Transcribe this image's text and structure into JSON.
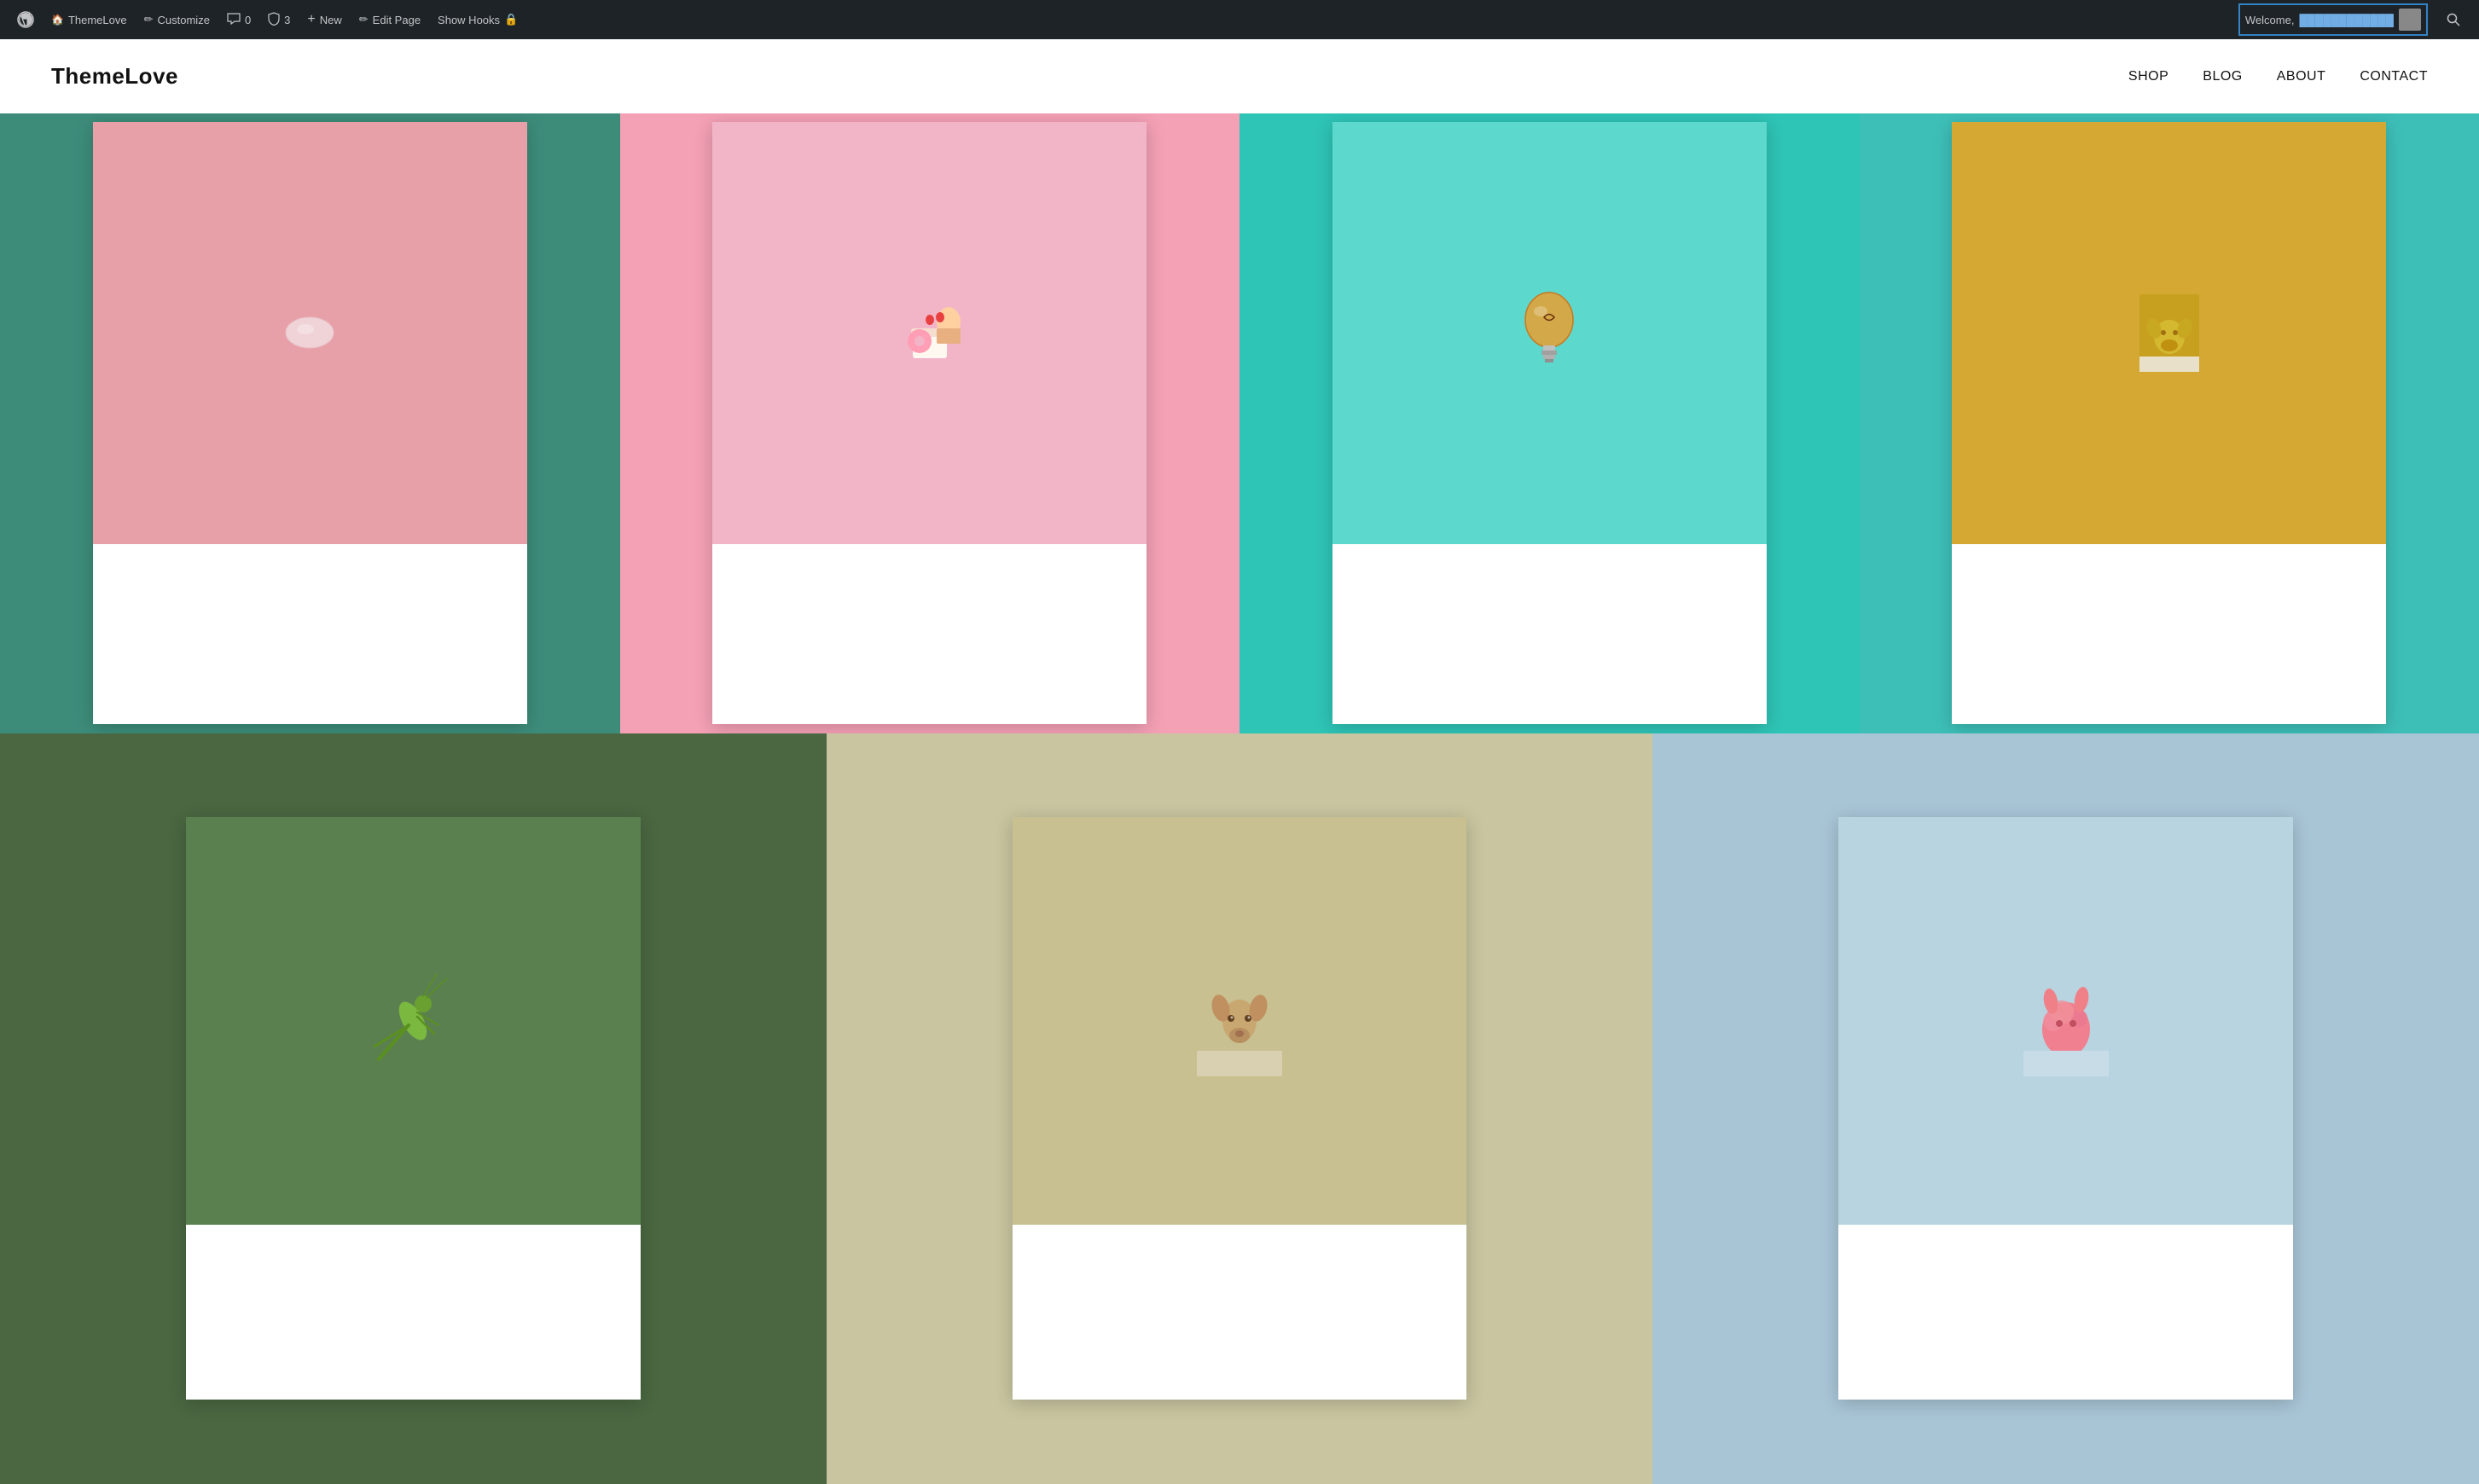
{
  "adminBar": {
    "wpIcon": "⊞",
    "items": [
      {
        "id": "themelove",
        "label": "ThemeLove",
        "icon": "🏠"
      },
      {
        "id": "customize",
        "label": "Customize",
        "icon": "✏️"
      },
      {
        "id": "comments",
        "label": "0",
        "icon": "💬"
      },
      {
        "id": "security",
        "label": "3",
        "icon": "🛡"
      },
      {
        "id": "new",
        "label": "New",
        "icon": "+"
      },
      {
        "id": "edit-page",
        "label": "Edit Page",
        "icon": "✏️"
      },
      {
        "id": "show-hooks",
        "label": "Show Hooks",
        "icon": "🔒"
      }
    ],
    "welcome": "Welcome,",
    "searchIcon": "🔍"
  },
  "header": {
    "logo": "ThemeLove",
    "nav": [
      {
        "id": "shop",
        "label": "SHOP"
      },
      {
        "id": "blog",
        "label": "BLOG"
      },
      {
        "id": "about",
        "label": "ABOUT"
      },
      {
        "id": "contact",
        "label": "CONTACT"
      }
    ]
  },
  "gallery": {
    "rows": [
      {
        "id": "row-1",
        "cells": [
          {
            "id": "cell-1",
            "bg": "bg-teal-dark",
            "artClass": "art-1",
            "alt": "Pink candy on pink background"
          },
          {
            "id": "cell-2",
            "bg": "bg-pink",
            "artClass": "art-2",
            "alt": "Sweets and donuts on pink background"
          },
          {
            "id": "cell-3",
            "bg": "bg-teal",
            "artClass": "art-3",
            "alt": "Light bulb on teal background"
          },
          {
            "id": "cell-4",
            "bg": "bg-teal-med",
            "artClass": "art-4",
            "alt": "Animal head on yellow background"
          }
        ]
      },
      {
        "id": "row-2",
        "cells": [
          {
            "id": "cell-5",
            "bg": "bg-green-dark",
            "artClass": "art-5",
            "alt": "Grasshopper on green background"
          },
          {
            "id": "cell-6",
            "bg": "bg-tan",
            "artClass": "art-6",
            "alt": "Deer head on tan background"
          },
          {
            "id": "cell-7",
            "bg": "bg-blue-light",
            "artClass": "art-7",
            "alt": "Pink fluffy animal on blue background"
          }
        ]
      }
    ]
  }
}
